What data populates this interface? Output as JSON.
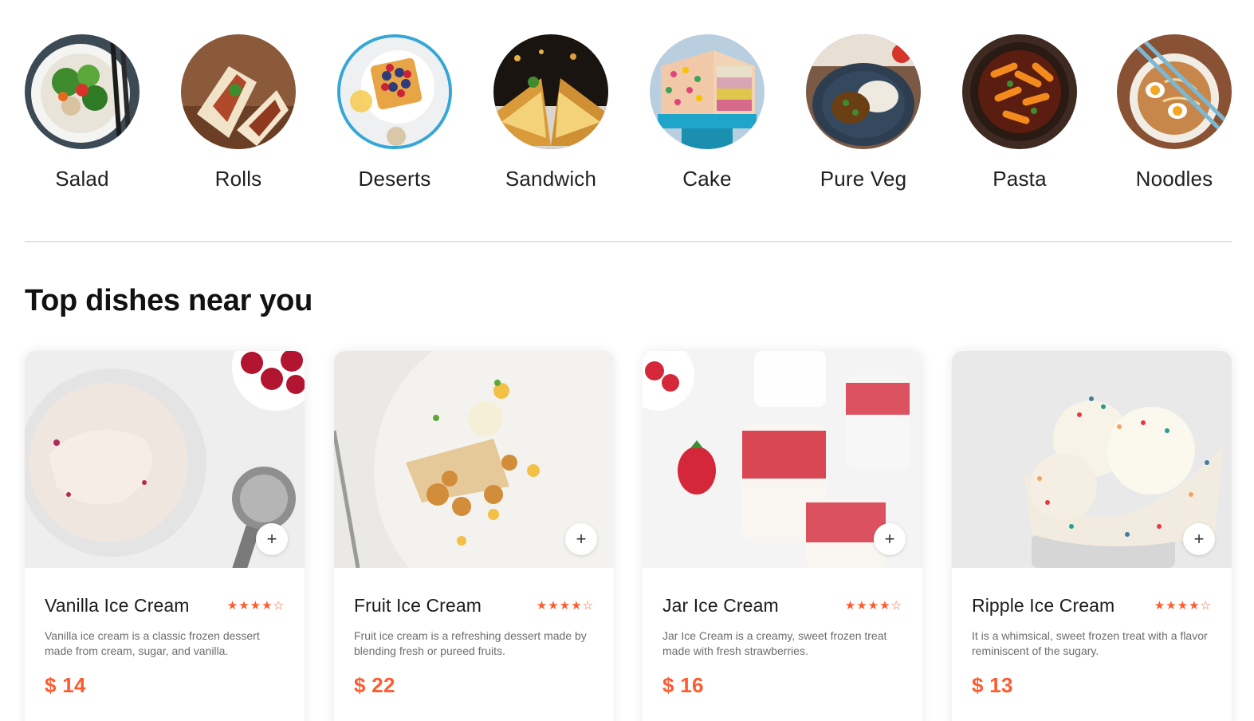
{
  "categories": [
    {
      "label": "Salad",
      "icon": "salad-image",
      "active": false
    },
    {
      "label": "Rolls",
      "icon": "rolls-image",
      "active": false
    },
    {
      "label": "Deserts",
      "icon": "deserts-image",
      "active": true
    },
    {
      "label": "Sandwich",
      "icon": "sandwich-image",
      "active": false
    },
    {
      "label": "Cake",
      "icon": "cake-image",
      "active": false
    },
    {
      "label": "Pure Veg",
      "icon": "pure-veg-image",
      "active": false
    },
    {
      "label": "Pasta",
      "icon": "pasta-image",
      "active": false
    },
    {
      "label": "Noodles",
      "icon": "noodles-image",
      "active": false
    }
  ],
  "section": {
    "title": "Top dishes near you"
  },
  "dishes": [
    {
      "name": "Vanilla Ice Cream",
      "rating": 4,
      "rating_max": 5,
      "description": "Vanilla ice cream is a classic frozen dessert made from cream, sugar, and vanilla.",
      "price": "$ 14",
      "add_label": "+"
    },
    {
      "name": "Fruit Ice Cream",
      "rating": 4,
      "rating_max": 5,
      "description": "Fruit ice cream is a refreshing dessert made by blending fresh or pureed fruits.",
      "price": "$ 22",
      "add_label": "+"
    },
    {
      "name": "Jar Ice Cream",
      "rating": 4,
      "rating_max": 5,
      "description": "Jar Ice Cream is a creamy, sweet frozen treat made with fresh strawberries.",
      "price": "$ 16",
      "add_label": "+"
    },
    {
      "name": "Ripple Ice Cream",
      "rating": 4,
      "rating_max": 5,
      "description": "It is a whimsical, sweet frozen treat with a flavor reminiscent of the sugary.",
      "price": "$ 13",
      "add_label": "+"
    }
  ],
  "colors": {
    "accent": "#ff5b2e",
    "active_ring": "#34a7d6",
    "divider": "#e2e2e2"
  }
}
